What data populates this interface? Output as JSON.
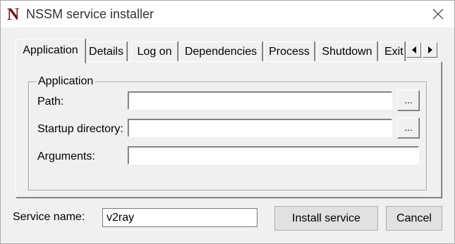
{
  "window": {
    "title": "NSSM service installer",
    "logo_text": "N",
    "close_icon": "close-icon"
  },
  "tabs": [
    {
      "label": "Application",
      "selected": true
    },
    {
      "label": "Details",
      "selected": false
    },
    {
      "label": "Log on",
      "selected": false
    },
    {
      "label": "Dependencies",
      "selected": false
    },
    {
      "label": "Process",
      "selected": false
    },
    {
      "label": "Shutdown",
      "selected": false
    },
    {
      "label": "Exit",
      "selected": false
    }
  ],
  "tab_scroll": {
    "left_icon": "arrow-left-icon",
    "right_icon": "arrow-right-icon"
  },
  "application_group": {
    "title": "Application",
    "path_label": "Path:",
    "path_value": "",
    "startup_dir_label": "Startup directory:",
    "startup_dir_value": "",
    "arguments_label": "Arguments:",
    "arguments_value": "",
    "browse_label": "..."
  },
  "footer": {
    "service_name_label": "Service name:",
    "service_name_value": "v2ray",
    "install_label": "Install service",
    "cancel_label": "Cancel"
  },
  "colors": {
    "logo": "#7a1117",
    "dialog_bg": "#f0f0f0",
    "button_bg": "#e1e1e1"
  }
}
